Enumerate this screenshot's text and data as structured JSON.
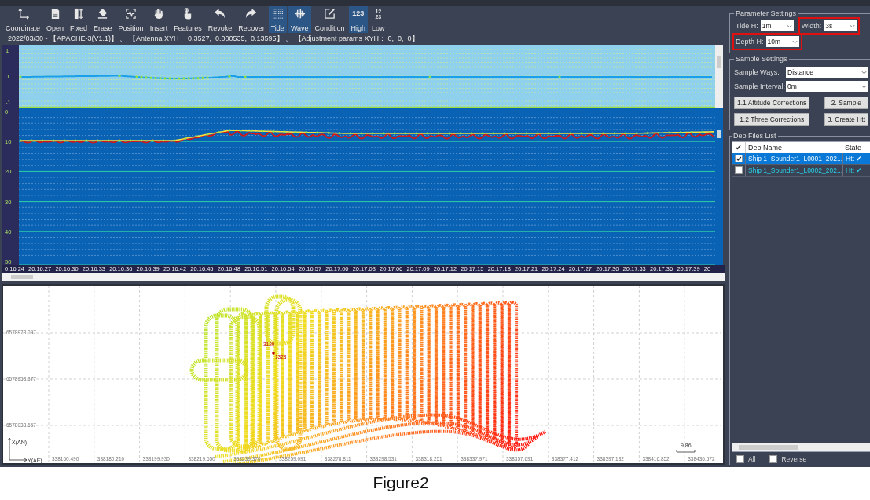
{
  "toolbar": [
    {
      "label": "Coordinate",
      "active": false
    },
    {
      "label": "Open",
      "active": false
    },
    {
      "label": "Fixed",
      "active": false
    },
    {
      "label": "Erase",
      "active": false
    },
    {
      "label": "Position",
      "active": false
    },
    {
      "label": "Insert",
      "active": false
    },
    {
      "label": "Features",
      "active": false
    },
    {
      "label": "Revoke",
      "active": false
    },
    {
      "label": "Recover",
      "active": false
    },
    {
      "label": "Tide",
      "active": true
    },
    {
      "label": "Wave",
      "active": true
    },
    {
      "label": "Condition",
      "active": false
    },
    {
      "label": "High",
      "active": true,
      "icon_text": [
        "123"
      ]
    },
    {
      "label": "Low",
      "active": false,
      "icon_text": [
        "12",
        "23"
      ]
    }
  ],
  "info_line": "2022/03/30 - 【APACHE-3(V1.1)】 、 【Antenna XYH： 0.3527,  0.000535,  0.13595】 、 【Adjustment params XYH： 0,  0,  0】",
  "tide_chart": {
    "y_ticks": [
      "1",
      "0",
      "-1"
    ]
  },
  "depth_chart": {
    "y_ticks": [
      "0",
      "10",
      "20",
      "30",
      "40",
      "50"
    ]
  },
  "time_axis": [
    "0:16:24",
    "20:16:27",
    "20:16:30",
    "20:16:33",
    "20:16:36",
    "20:16:39",
    "20:16:42",
    "20:16:45",
    "20:16:48",
    "20:16:51",
    "20:16:54",
    "20:16:57",
    "20:17:00",
    "20:17:03",
    "20:17:06",
    "20:17:09",
    "20:17:12",
    "20:17:15",
    "20:17:18",
    "20:17:21",
    "20:17:24",
    "20:17:27",
    "20:17:30",
    "20:17:33",
    "20:17:36",
    "20:17:39",
    "20"
  ],
  "map": {
    "x_ticks": [
      "338160.490",
      "338180.210",
      "338199.930",
      "338219.650",
      "338239.370",
      "338259.091",
      "338278.811",
      "338298.531",
      "338318.251",
      "338337.971",
      "338357.691",
      "338377.412",
      "338397.132",
      "338416.852",
      "338436.572"
    ],
    "y_ticks": [
      "6578973.097",
      "6578953.377",
      "6578933.657"
    ],
    "y_axis_label": "X(AN)",
    "x_axis_label": "Y(AE)",
    "scale_label": "9.86",
    "point_labels": [
      "3120",
      "1328"
    ]
  },
  "parameter_settings": {
    "title": "Parameter Settings",
    "fields": [
      {
        "label": "Tide H:",
        "value": "1m",
        "highlighted": false
      },
      {
        "label": "Width:",
        "value": "3s",
        "highlighted": true
      },
      {
        "label": "Depth H:",
        "value": "10m",
        "highlighted": true
      }
    ]
  },
  "sample_settings": {
    "title": "Sample Settings",
    "fields": [
      {
        "label": "Sample Ways:",
        "value": "Distance"
      },
      {
        "label": "Sample Interval:",
        "value": "0m"
      }
    ],
    "buttons": [
      "1.1 Attitude Corrections",
      "2. Sample",
      "1.2 Three Corrections",
      "3. Create Htt"
    ]
  },
  "dep_files": {
    "title": "Dep Files List",
    "columns": [
      "✔",
      "Dep Name",
      "State"
    ],
    "rows": [
      {
        "name": "Ship 1_Sounder1_L0001_202...",
        "state": "Htt ✔",
        "checked": true,
        "selected": true
      },
      {
        "name": "Ship 1_Sounder1_L0002_202...",
        "state": "Htt ✔",
        "checked": false,
        "selected": false
      }
    ],
    "options": [
      {
        "label": "All",
        "checked": false
      },
      {
        "label": "Reverse",
        "checked": false
      }
    ]
  },
  "caption": "Figure2"
}
